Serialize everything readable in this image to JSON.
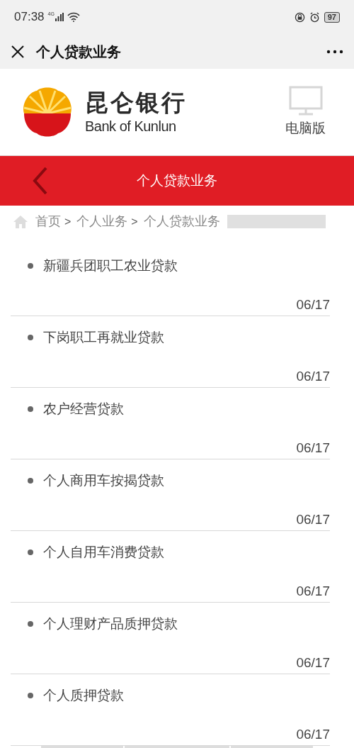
{
  "status_bar": {
    "time": "07:38",
    "network": "4G",
    "battery": "97"
  },
  "title_bar": {
    "title": "个人贷款业务"
  },
  "header": {
    "bank_name": "昆仑银行",
    "bank_name_en": "Bank of Kunlun",
    "desktop_label": "电脑版"
  },
  "nav_bar": {
    "title": "个人贷款业务"
  },
  "breadcrumb": {
    "items": [
      "首页",
      "个人业务",
      "个人贷款业务"
    ],
    "separators": [
      ">",
      ">"
    ]
  },
  "articles": [
    {
      "title": "新疆兵团职工农业贷款",
      "date": "06/17"
    },
    {
      "title": "下岗职工再就业贷款",
      "date": "06/17"
    },
    {
      "title": "农户经营贷款",
      "date": "06/17"
    },
    {
      "title": "个人商用车按揭贷款",
      "date": "06/17"
    },
    {
      "title": "个人自用车消费贷款",
      "date": "06/17"
    },
    {
      "title": "个人理财产品质押贷款",
      "date": "06/17"
    },
    {
      "title": "个人质押贷款",
      "date": "06/17"
    }
  ]
}
